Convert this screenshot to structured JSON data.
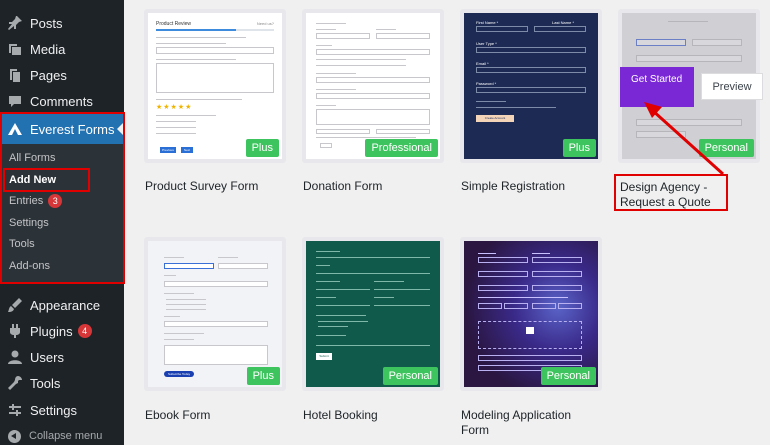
{
  "sidebar": {
    "items": [
      {
        "label": "Posts",
        "icon": "pin-icon"
      },
      {
        "label": "Media",
        "icon": "media-icon"
      },
      {
        "label": "Pages",
        "icon": "pages-icon"
      },
      {
        "label": "Comments",
        "icon": "comment-icon"
      }
    ],
    "everest": {
      "label": "Everest Forms",
      "icon": "everest-forms-icon"
    },
    "submenu": [
      {
        "label": "All Forms"
      },
      {
        "label": "Add New"
      },
      {
        "label": "Entries",
        "badge": "3"
      },
      {
        "label": "Settings"
      },
      {
        "label": "Tools"
      },
      {
        "label": "Add-ons"
      }
    ],
    "lower": [
      {
        "label": "Appearance",
        "icon": "brush-icon"
      },
      {
        "label": "Plugins",
        "icon": "plugin-icon",
        "badge": "4"
      },
      {
        "label": "Users",
        "icon": "user-icon"
      },
      {
        "label": "Tools",
        "icon": "wrench-icon"
      },
      {
        "label": "Settings",
        "icon": "settings-icon"
      }
    ],
    "collapse": "Collapse menu"
  },
  "templates": [
    {
      "title": "Product Survey Form",
      "tag": "Plus"
    },
    {
      "title": "Donation Form",
      "tag": "Professional"
    },
    {
      "title": "Simple Registration",
      "tag": "Plus"
    },
    {
      "title": "Design Agency - Request a Quote",
      "tag": "Personal"
    },
    {
      "title": "Ebook Form",
      "tag": "Plus"
    },
    {
      "title": "Hotel Booking",
      "tag": "Personal"
    },
    {
      "title": "Modeling Application Form",
      "tag": "Personal"
    }
  ],
  "hover": {
    "get_started": "Get Started",
    "preview": "Preview"
  },
  "thumb_text": {
    "survey_title": "Product Review",
    "survey_help": "Need us?",
    "survey_prev": "Previous",
    "survey_next": "Next",
    "simple_first": "First Name *",
    "simple_last": "Last Name *",
    "simple_user": "User Type *",
    "simple_email": "Email *",
    "simple_pass": "Password *",
    "simple_btn": "Create Account",
    "ebook_btn": "Subscribe Today",
    "hotel_submit": "Submit"
  },
  "colors": {
    "sidebar_bg": "#1d2327",
    "accent": "#2271b1",
    "badge": "#d63638",
    "tag_green": "#3ec45e",
    "highlight_red": "#e00000",
    "purple": "#7a28d6"
  }
}
